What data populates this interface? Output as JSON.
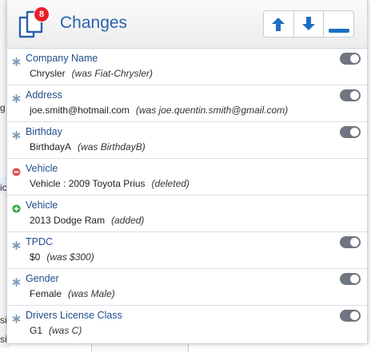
{
  "header": {
    "title": "Changes",
    "badge_count": "8"
  },
  "colors": {
    "accent": "#2a62ad",
    "badge": "#e8202a",
    "deleted": "#d9534f",
    "added": "#28a745",
    "modified": "#7a9ab5",
    "toggle": "#6e7680"
  },
  "background_fragments": [
    "g",
    "ic",
    "si",
    "si"
  ],
  "changes": [
    {
      "label": "Company Name",
      "value": "Chrysler",
      "note": "(was Fiat-Chrysler)",
      "icon": "asterisk-icon",
      "toggle": true
    },
    {
      "label": "Address",
      "value": "joe.smith@hotmail.com",
      "note": "(was joe.quentin.smith@gmail.com)",
      "icon": "asterisk-icon",
      "toggle": true
    },
    {
      "label": "Birthday",
      "value": "BirthdayA",
      "note": "(was BirthdayB)",
      "icon": "asterisk-icon",
      "toggle": true
    },
    {
      "label": "Vehicle",
      "value": "Vehicle : 2009 Toyota Prius",
      "note": "(deleted)",
      "icon": "minus-circle-icon",
      "toggle": false
    },
    {
      "label": "Vehicle",
      "value": "2013 Dodge Ram",
      "note": "(added)",
      "icon": "plus-circle-icon",
      "toggle": false
    },
    {
      "label": "TPDC",
      "value": "$0",
      "note": "(was $300)",
      "icon": "asterisk-icon",
      "toggle": true
    },
    {
      "label": "Gender",
      "value": "Female",
      "note": "(was Male)",
      "icon": "asterisk-icon",
      "toggle": true
    },
    {
      "label": "Drivers License Class",
      "value": "G1",
      "note": "(was C)",
      "icon": "asterisk-icon",
      "toggle": true
    }
  ]
}
